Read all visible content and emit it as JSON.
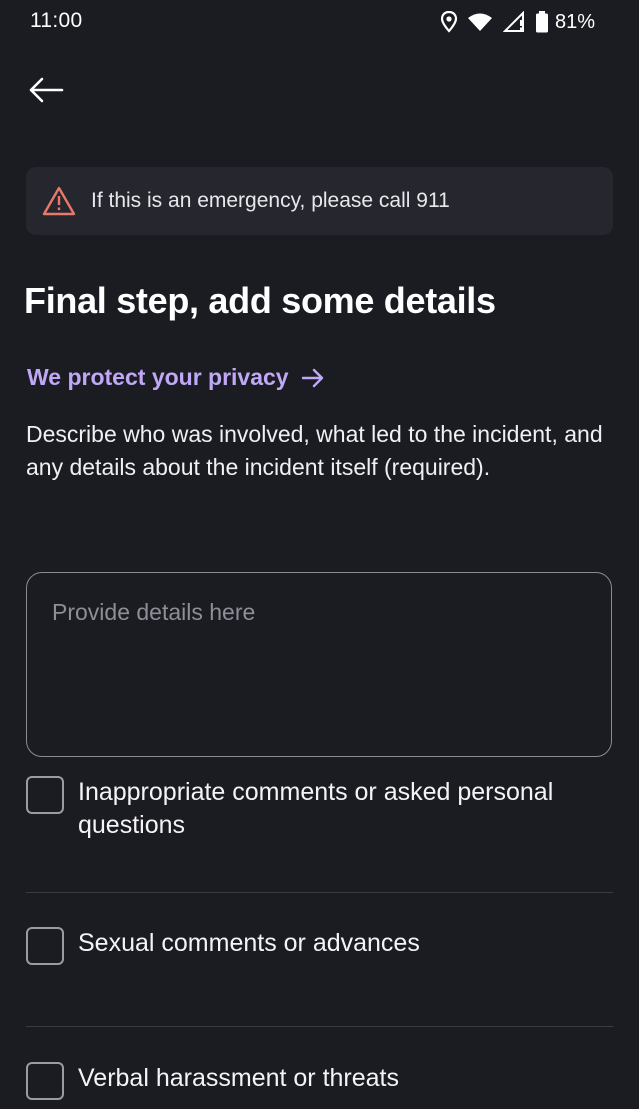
{
  "status_bar": {
    "time": "11:00",
    "battery_pct": "81%",
    "icons": [
      "location-icon",
      "wifi-icon",
      "signal-icon",
      "battery-icon"
    ]
  },
  "nav": {
    "back_icon": "arrow-left-icon"
  },
  "banner": {
    "icon": "warning-triangle-icon",
    "text": "If this is an emergency, please call 911",
    "icon_color": "#e8796a"
  },
  "page": {
    "title": "Final step, add some details",
    "privacy_link": "We protect your privacy",
    "privacy_link_icon": "arrow-right-icon",
    "description": "Describe who was involved, what led to the incident, and any details about the incident itself (required)."
  },
  "details": {
    "placeholder": "Provide details here",
    "value": ""
  },
  "options": [
    {
      "label": "Inappropriate comments or asked personal questions",
      "checked": false
    },
    {
      "label": "Sexual comments or advances",
      "checked": false
    },
    {
      "label": "Verbal harassment or threats",
      "checked": false
    }
  ],
  "colors": {
    "background": "#1b1c22",
    "accent": "#c0a8f7",
    "banner_bg": "#25262e"
  }
}
